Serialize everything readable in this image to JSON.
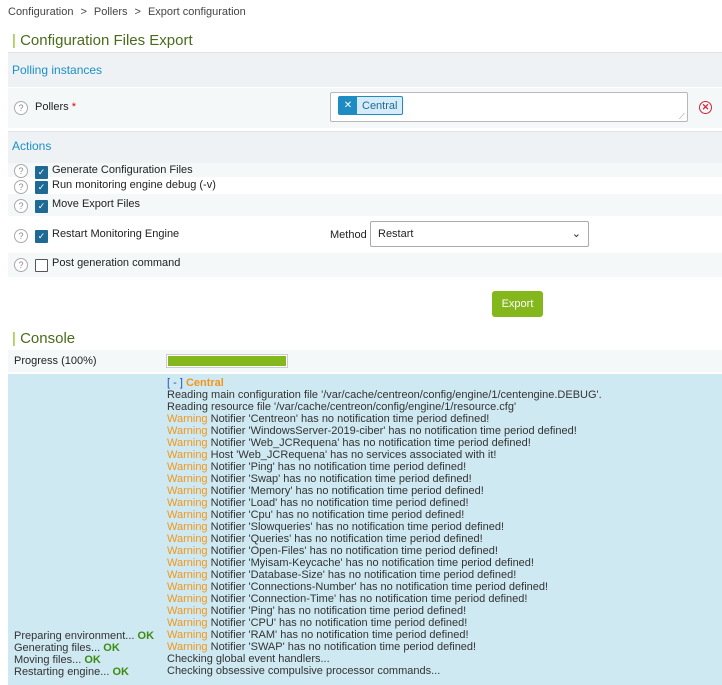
{
  "breadcrumb": [
    "Configuration",
    "Pollers",
    "Export configuration"
  ],
  "page_title": "Configuration Files Export",
  "polling": {
    "band": "Polling instances",
    "pollers_label": "Pollers",
    "required": "*",
    "selected": [
      "Central"
    ]
  },
  "actions": {
    "band": "Actions",
    "items": [
      {
        "label": "Generate Configuration Files",
        "checked": true
      },
      {
        "label": "Run monitoring engine debug (-v)",
        "checked": true
      },
      {
        "label": "Move Export Files",
        "checked": true
      },
      {
        "label": "Restart Monitoring Engine",
        "checked": true
      },
      {
        "label": "Post generation command",
        "checked": false
      }
    ],
    "method_label": "Method",
    "method_value": "Restart",
    "export_button": "Export"
  },
  "console": {
    "title": "Console",
    "progress_prefix": "Progress (",
    "progress_value": "100%",
    "progress_suffix": ")",
    "progress_fraction": 1.0,
    "toggle": "[ - ]",
    "poller": "Central",
    "lines": [
      {
        "prefix": "",
        "text": "Reading main configuration file '/var/cache/centreon/config/engine/1/centengine.DEBUG'."
      },
      {
        "prefix": "",
        "text": "Reading resource file '/var/cache/centreon/config/engine/1/resource.cfg'"
      },
      {
        "prefix": "Warning",
        "text": " Notifier 'Centreon' has no notification time period defined!"
      },
      {
        "prefix": "Warning",
        "text": " Notifier 'WindowsServer-2019-ciber' has no notification time period defined!"
      },
      {
        "prefix": "Warning",
        "text": " Notifier 'Web_JCRequena' has no notification time period defined!"
      },
      {
        "prefix": "Warning",
        "text": " Host 'Web_JCRequena' has no services associated with it!"
      },
      {
        "prefix": "Warning",
        "text": " Notifier 'Ping' has no notification time period defined!"
      },
      {
        "prefix": "Warning",
        "text": " Notifier 'Swap' has no notification time period defined!"
      },
      {
        "prefix": "Warning",
        "text": " Notifier 'Memory' has no notification time period defined!"
      },
      {
        "prefix": "Warning",
        "text": " Notifier 'Load' has no notification time period defined!"
      },
      {
        "prefix": "Warning",
        "text": " Notifier 'Cpu' has no notification time period defined!"
      },
      {
        "prefix": "Warning",
        "text": " Notifier 'Slowqueries' has no notification time period defined!"
      },
      {
        "prefix": "Warning",
        "text": " Notifier 'Queries' has no notification time period defined!"
      },
      {
        "prefix": "Warning",
        "text": " Notifier 'Open-Files' has no notification time period defined!"
      },
      {
        "prefix": "Warning",
        "text": " Notifier 'Myisam-Keycache' has no notification time period defined!"
      },
      {
        "prefix": "Warning",
        "text": " Notifier 'Database-Size' has no notification time period defined!"
      },
      {
        "prefix": "Warning",
        "text": " Notifier 'Connections-Number' has no notification time period defined!"
      },
      {
        "prefix": "Warning",
        "text": " Notifier 'Connection-Time' has no notification time period defined!"
      },
      {
        "prefix": "Warning",
        "text": " Notifier 'Ping' has no notification time period defined!"
      },
      {
        "prefix": "Warning",
        "text": " Notifier 'CPU' has no notification time period defined!"
      },
      {
        "prefix": "Warning",
        "text": " Notifier 'RAM' has no notification time period defined!"
      },
      {
        "prefix": "Warning",
        "text": " Notifier 'SWAP' has no notification time period defined!"
      },
      {
        "prefix": "",
        "text": "Checking global event handlers..."
      },
      {
        "prefix": "",
        "text": "Checking obsessive compulsive processor commands..."
      }
    ],
    "steps": [
      {
        "label": "Preparing environment...",
        "status": "OK"
      },
      {
        "label": "Generating files...",
        "status": "OK"
      },
      {
        "label": "Moving files...",
        "status": "OK"
      },
      {
        "label": "Restarting engine...",
        "status": "OK"
      }
    ]
  },
  "colors": {
    "accent": "#84b71c",
    "link": "#1c8fc6",
    "warning": "#f0961a",
    "console_bg": "#cfe9f2"
  }
}
